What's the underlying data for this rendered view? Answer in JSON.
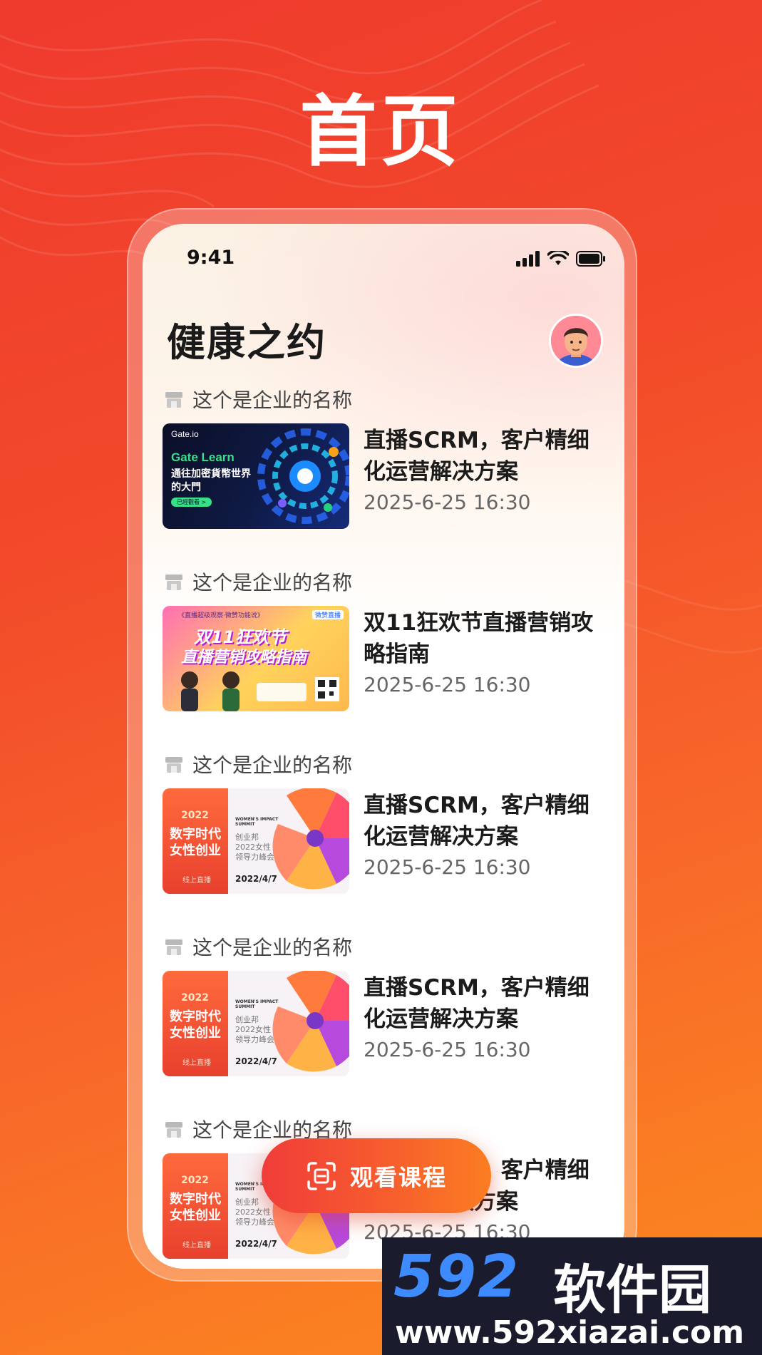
{
  "page": {
    "heading": "首页"
  },
  "status_bar": {
    "time": "9:41"
  },
  "app": {
    "title": "健康之约"
  },
  "feed": [
    {
      "company": "这个是企业的名称",
      "title": "直播SCRM，客户精细化运营解决方案",
      "date": "2025-6-25 16:30",
      "thumb": {
        "kind": "gate",
        "brand": "Gate.io",
        "headline": "Gate Learn",
        "sub1": "通往加密貨幣世界",
        "sub2": "的大門",
        "button": "已經觀看 >"
      }
    },
    {
      "company": "这个是企业的名称",
      "title": "双11狂欢节直播营销攻略指南",
      "date": "2025-6-25 16:30",
      "thumb": {
        "kind": "d11",
        "top": "《直播超级观察·微赞功能说》",
        "line1": "双11狂欢节",
        "line2": "直播营销攻略指南",
        "tag": "微赞直播"
      }
    },
    {
      "company": "这个是企业的名称",
      "title": "直播SCRM，客户精细化运营解决方案",
      "date": "2025-6-25 16:30",
      "thumb": {
        "kind": "women",
        "year": "2022",
        "line1": "数字时代",
        "line2": "女性创业",
        "live": "线上直播",
        "en": "WOMEN'S IMPACT SUMMIT",
        "org": "创业邦",
        "event1": "2022女性",
        "event2": "领导力峰会",
        "date": "2022/4/7"
      }
    },
    {
      "company": "这个是企业的名称",
      "title": "直播SCRM，客户精细化运营解决方案",
      "date": "2025-6-25 16:30",
      "thumb": {
        "kind": "women",
        "year": "2022",
        "line1": "数字时代",
        "line2": "女性创业",
        "live": "线上直播",
        "en": "WOMEN'S IMPACT SUMMIT",
        "org": "创业邦",
        "event1": "2022女性",
        "event2": "领导力峰会",
        "date": "2022/4/7"
      }
    },
    {
      "company": "这个是企业的名称",
      "title": "直播SCRM，客户精细化运营解决方案",
      "date": "2025-6-25 16:30",
      "thumb": {
        "kind": "women",
        "year": "2022",
        "line1": "数字时代",
        "line2": "女性创业",
        "live": "线上直播",
        "en": "WOMEN'S IMPACT SUMMIT",
        "org": "创业邦",
        "event1": "2022女性",
        "event2": "领导力峰会",
        "date": "2022/4/7"
      }
    }
  ],
  "cta": {
    "label": "观看课程",
    "icon": "scan-icon"
  },
  "watermark": {
    "brand": "592",
    "brand_cn": "软件园",
    "url": "www.592xiazai.com"
  },
  "colors": {
    "accent": "#f24a2a",
    "accent_end": "#fb8a1e",
    "watermark_blue": "#3d8bff"
  }
}
